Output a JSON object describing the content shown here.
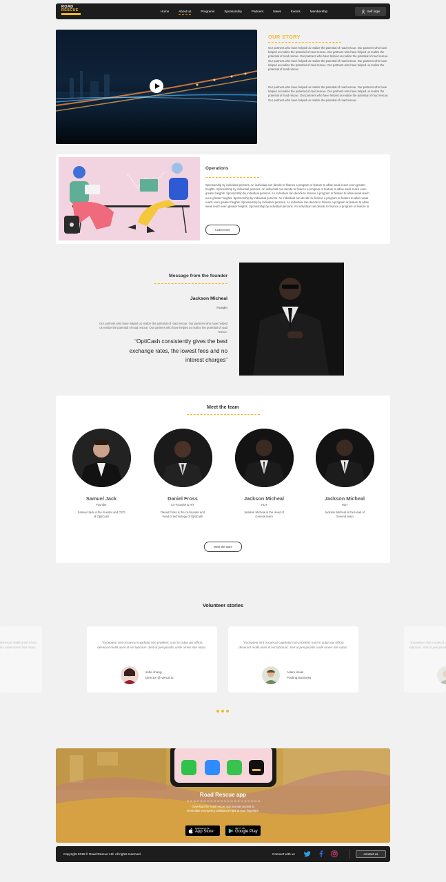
{
  "brand": {
    "line1": "ROAD",
    "line2": "RESCUE",
    "accent": "#f5b72d"
  },
  "nav": {
    "items": [
      "Home",
      "About us",
      "Programs",
      "Sponsorship",
      "Partners",
      "News",
      "Events",
      "Membership"
    ],
    "active": "About us",
    "login_label": "Self login"
  },
  "story": {
    "title": "OUR STORY",
    "p1": "Our partners who have helped us realize the potential of road rescue. Our partners who have helped us realize the potential of road rescue. Our partners who have helped us realize the potential of road rescue. Our partners who have helped us realize the potential of road rescue. Our partners who have helped us realize the potential of road rescue. Our partners who have helped us realize the potential of road rescue. Our partners who have helped us realize the potential of road rescue.",
    "p2": "Our partners who have helped us realize the potential of road rescue. Our partners who have helped us realize the potential of road rescue. Our partners who have helped us realize the potential of road rescue. Our partners who have helped us realize the potential of road rescue. Our partners who have helped us realize the potential of road rescue."
  },
  "operations": {
    "title": "Operations",
    "text": "Sponsorship by individual persons. An individual can decide to finance a program or feature to allow weak reach even greater heights. Sponsorship by individual persons. An individual can decide to finance a program or feature to allow weak reach even greater heights. Sponsorship by individual persons. An individual can decide to finance a program or feature to allow weak reach even greater heights. Sponsorship by individual persons. An individual can decide to finance a program or feature to allow weak reach even greater heights. Sponsorship by individual persons. An individual can decide to finance a program or feature to allow weak reach even greater heights. Sponsorship by individual persons. An individual can decide to finance a program or feature to",
    "button": "Learn more"
  },
  "founder": {
    "heading": "Message from the founder",
    "name": "Jackson Micheal",
    "role": "Founder",
    "text": "Our partners who have helped us realize the potential of road rescue. Our partners who have helped us realize the potential of road rescue. Our partners who have helped us realize the potential of road rescue.",
    "quote": "“OptiCash consistently gives the best exchange rates, the lowest fees and no interest charges”"
  },
  "team": {
    "title": "Meet the team",
    "button": "Meet the team",
    "members": [
      {
        "name": "Samuel Jack",
        "role": "Founder",
        "desc": "Samuel Jack is the founder and CEO of OptiCash"
      },
      {
        "name": "Daniel Fross",
        "role": "Co-Founder & HIT",
        "desc": "Daniel Fross is the co-founder and head of technology of OptiCash"
      },
      {
        "name": "Jackson Micheal",
        "role": "HLH",
        "desc": "Jackson Micheal is the Head of General team"
      },
      {
        "name": "Jackson Micheal",
        "role": "HLH",
        "desc": "Jackson Micheal is the Head of General team"
      }
    ]
  },
  "volunteer": {
    "title": "Volunteer stories",
    "quote": "“Excepteur sint occaecat cupidatat non proident, sunt in culpa qui officia deserunt mollit anim id est laborum. Sed ut perspiciatis unde omnis iste natus.",
    "stories": [
      {
        "name": "sofia chang",
        "org": "Director @ vercai.io"
      },
      {
        "name": "Adam israel",
        "org": "Pooling Business"
      }
    ]
  },
  "app": {
    "title": "Road Rescue app",
    "desc": "Download the road rescue app and get access to immediate emergency assistance right at your fingertips.",
    "appstore_small": "Download on the",
    "appstore_large": "App Store",
    "gplay_small": "GET IT ON",
    "gplay_large": "Google Play"
  },
  "footer": {
    "copyright": "Copyright 2019 © Road Rescue Ltd.  All rights reserved.",
    "connect": "Connect with us",
    "contact": "contact us"
  }
}
